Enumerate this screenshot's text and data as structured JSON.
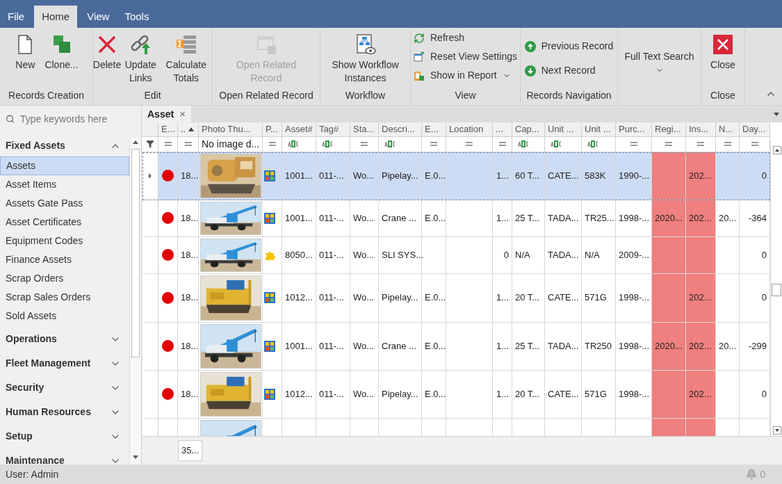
{
  "menu_tabs": [
    {
      "label": "File",
      "selected": false
    },
    {
      "label": "Home",
      "selected": true
    },
    {
      "label": "View",
      "selected": false
    },
    {
      "label": "Tools",
      "selected": false
    }
  ],
  "ribbon_groups": [
    {
      "label": "Records Creation",
      "buttons": [
        {
          "kind": "new",
          "label": "New",
          "disabled": false
        },
        {
          "kind": "clone",
          "label": "Clone...",
          "disabled": false
        }
      ]
    },
    {
      "label": "Edit",
      "buttons": [
        {
          "kind": "delete",
          "label": "Delete",
          "disabled": false
        },
        {
          "kind": "links",
          "label": "Update Links",
          "disabled": false
        },
        {
          "kind": "totals",
          "label": "Calculate Totals",
          "disabled": false
        }
      ]
    },
    {
      "label": "Open Related Record",
      "buttons": [
        {
          "kind": "related",
          "label": "Open Related Record",
          "disabled": true
        }
      ]
    },
    {
      "label": "Workflow",
      "buttons": [
        {
          "kind": "workflow",
          "label": "Show Workflow Instances",
          "disabled": false
        }
      ]
    },
    {
      "label": "View",
      "small": [
        {
          "kind": "refresh",
          "label": "Refresh",
          "dropdown": false
        },
        {
          "kind": "reset",
          "label": "Reset View Settings",
          "dropdown": false
        },
        {
          "kind": "report",
          "label": "Show in Report",
          "dropdown": true
        }
      ]
    },
    {
      "label": "Records Navigation",
      "small": [
        {
          "kind": "up",
          "label": "Previous Record",
          "dropdown": false
        },
        {
          "kind": "down",
          "label": "Next Record",
          "dropdown": false
        }
      ]
    },
    {
      "buttons": [
        {
          "kind": "search",
          "label": "Full Text Search",
          "disabled": false,
          "dropdown": true
        }
      ]
    },
    {
      "label": "Close",
      "buttons": [
        {
          "kind": "close",
          "label": "Close",
          "disabled": false
        }
      ]
    }
  ],
  "sidebar": {
    "search": {
      "placeholder": "Type keywords here"
    },
    "groups": [
      {
        "label": "Fixed Assets",
        "expanded": true,
        "items": [
          {
            "label": "Assets",
            "selected": true
          },
          {
            "label": "Asset Items",
            "selected": false
          },
          {
            "label": "Assets Gate Pass",
            "selected": false
          },
          {
            "label": "Asset Certificates",
            "selected": false
          },
          {
            "label": "Equipment Codes",
            "selected": false
          },
          {
            "label": "Finance Assets",
            "selected": false
          },
          {
            "label": "Scrap Orders",
            "selected": false
          },
          {
            "label": "Scrap Sales Orders",
            "selected": false
          },
          {
            "label": "Sold Assets",
            "selected": false
          }
        ]
      },
      {
        "label": "Operations",
        "expanded": false
      },
      {
        "label": "Fleet Management",
        "expanded": false
      },
      {
        "label": "Security",
        "expanded": false
      },
      {
        "label": "Human Resources",
        "expanded": false
      },
      {
        "label": "Setup",
        "expanded": false
      },
      {
        "label": "Maintenance",
        "expanded": false
      }
    ]
  },
  "document_tab": {
    "label": "Asset",
    "close": "×"
  },
  "grid": {
    "columns": [
      {
        "label": "E...",
        "kind": "dot",
        "filter": {
          "kind": "equals"
        }
      },
      {
        "label": "..",
        "kind": "text",
        "filter": {
          "kind": "equals"
        },
        "sorted": true
      },
      {
        "label": "Photo Thu...",
        "filter": {
          "kind": "text",
          "value": "No image d..."
        }
      },
      {
        "label": "P...",
        "kind": "icon",
        "filter": {
          "kind": "equals"
        }
      },
      {
        "label": "Asset#",
        "kind": "text",
        "filter": {
          "kind": "contains"
        }
      },
      {
        "label": "Tag#",
        "kind": "text",
        "filter": {
          "kind": "contains"
        }
      },
      {
        "label": "Sta...",
        "kind": "text",
        "filter": {
          "kind": "equals"
        }
      },
      {
        "label": "Descri...",
        "kind": "text",
        "filter": {
          "kind": "contains"
        }
      },
      {
        "label": "E...",
        "kind": "text",
        "filter": {
          "kind": "equals"
        }
      },
      {
        "label": "Location",
        "kind": "text",
        "filter": {
          "kind": "equals"
        }
      },
      {
        "label": "...",
        "kind": "text",
        "filter": {
          "kind": "equals"
        },
        "numeric": true
      },
      {
        "label": "Cap...",
        "kind": "text",
        "filter": {
          "kind": "contains"
        }
      },
      {
        "label": "Unit ...",
        "kind": "text",
        "filter": {
          "kind": "contains"
        }
      },
      {
        "label": "Unit ...",
        "kind": "text",
        "filter": {
          "kind": "contains"
        }
      },
      {
        "label": "Purc...",
        "kind": "text",
        "filter": {
          "kind": "equals"
        }
      },
      {
        "label": "Regi...",
        "kind": "text",
        "filter": {
          "kind": "equals"
        },
        "alert": true
      },
      {
        "label": "Ins...",
        "kind": "text",
        "filter": {
          "kind": "equals"
        },
        "alert": true
      },
      {
        "label": "N...",
        "kind": "text",
        "filter": {
          "kind": "equals"
        }
      },
      {
        "label": "Day...",
        "kind": "text",
        "filter": {
          "kind": "equals"
        },
        "numeric": true
      }
    ],
    "rows": [
      {
        "selected": true,
        "color": "#e00000",
        "type_icon": {
          "kind": "grid"
        },
        "cells": [
          "18...",
          "1001...",
          "011-...",
          "Wo...",
          "Pipelay...",
          "E.0...",
          null,
          "1...",
          "60 T...",
          "CATE...",
          "583K",
          "1990-...",
          null,
          "202...",
          null,
          "0"
        ]
      },
      {
        "selected": false,
        "color": "#e00000",
        "type_icon": {
          "kind": "grid"
        },
        "cells": [
          "18...",
          "1001...",
          "011-...",
          "Wo...",
          "Crane ...",
          "E.0...",
          null,
          "1...",
          "25 T...",
          "TADA...",
          "TR25...",
          "1998-...",
          "2020...",
          "202...",
          "20...",
          "-364"
        ]
      },
      {
        "selected": false,
        "color": "#e00000",
        "type_icon": {
          "kind": "puzzle"
        },
        "cells": [
          "18...",
          "8050...",
          "011-...",
          "Wo...",
          "SLI SYS...",
          null,
          null,
          "0",
          "N/A",
          "TADA...",
          "N/A",
          "2009-...",
          null,
          null,
          null,
          "0"
        ]
      },
      {
        "selected": false,
        "color": "#e00000",
        "type_icon": {
          "kind": "grid"
        },
        "cells": [
          "18...",
          "1012...",
          "011-...",
          "Wo...",
          "Pipelay...",
          "E.0...",
          null,
          "1...",
          "20 T...",
          "CATE...",
          "571G",
          "1998-...",
          null,
          "202...",
          null,
          "0"
        ]
      },
      {
        "selected": false,
        "color": "#e00000",
        "type_icon": {
          "kind": "grid"
        },
        "cells": [
          "18...",
          "1001...",
          "011-...",
          "Wo...",
          "Crane ...",
          "E.0...",
          null,
          "1...",
          "25 T...",
          "TADA...",
          "TR250",
          "1998-...",
          "2020...",
          "202...",
          "20...",
          "-299"
        ]
      },
      {
        "selected": false,
        "color": "#e00000",
        "type_icon": {
          "kind": "grid"
        },
        "cells": [
          "18...",
          "1012...",
          "011-...",
          "Wo...",
          "Pipelay...",
          "E.0...",
          null,
          "1...",
          "20 T...",
          "CATE...",
          "571G",
          "1998-...",
          null,
          "202...",
          null,
          "0"
        ]
      },
      {
        "selected": false
      }
    ],
    "footer": {
      "count": "35..."
    }
  },
  "status_bar": {
    "user": "User: Admin",
    "notifications": "0"
  }
}
